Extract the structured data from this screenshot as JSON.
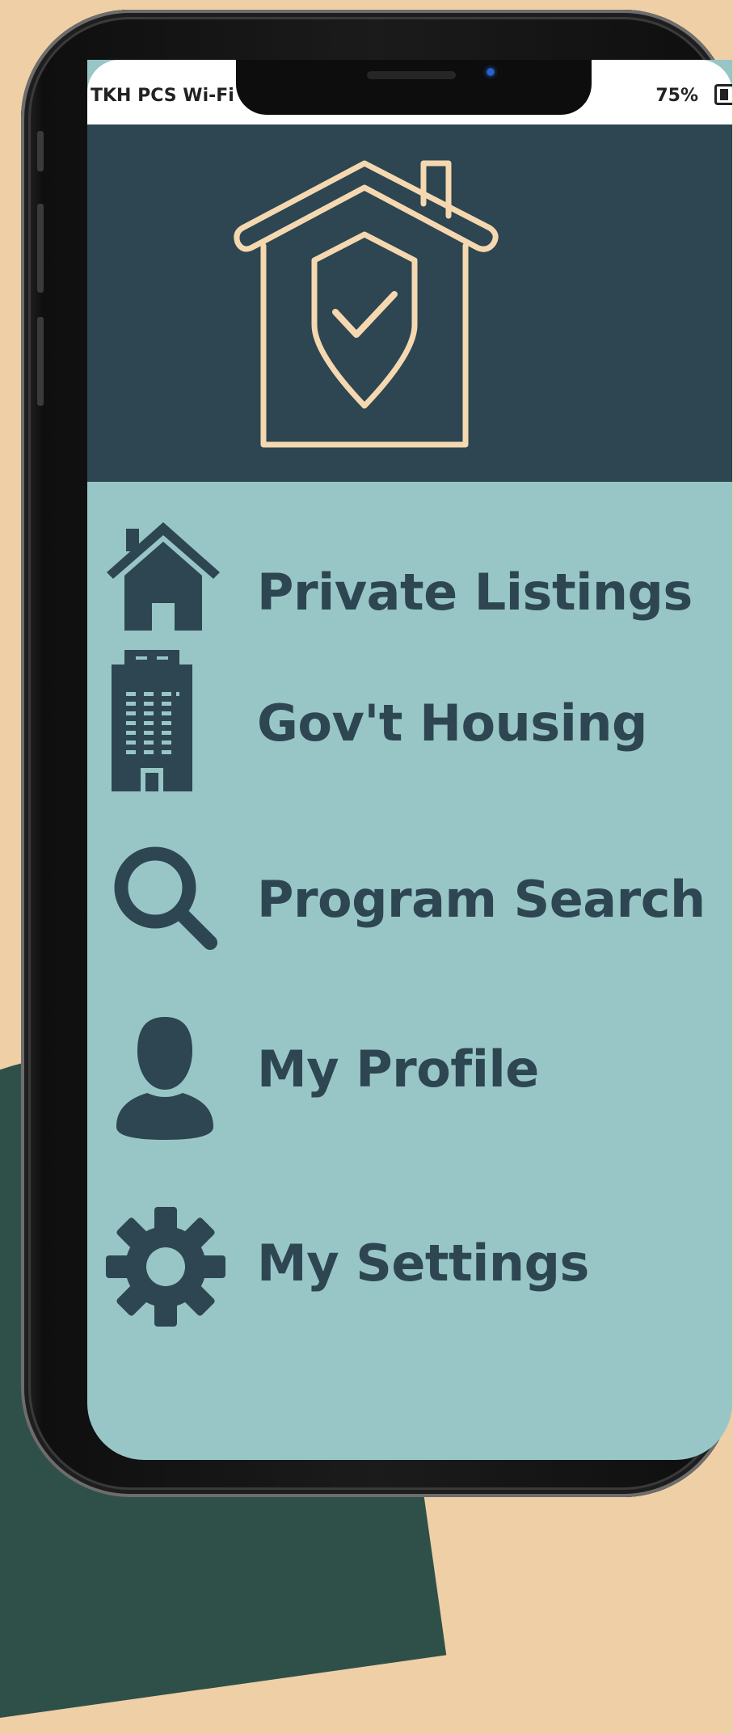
{
  "status_bar": {
    "carrier": "TKH PCS Wi-Fi",
    "battery_percent": "75%",
    "battery_icon": "battery-icon"
  },
  "hero": {
    "logo_icon": "house-shield-check-icon",
    "background_color": "#2D4651",
    "logo_color": "#F6D8B0"
  },
  "menu": {
    "items": [
      {
        "label": "Private Listings",
        "icon": "house-icon"
      },
      {
        "label": "Gov't Housing",
        "icon": "building-icon"
      },
      {
        "label": "Program Search",
        "icon": "search-icon"
      },
      {
        "label": "My Profile",
        "icon": "user-icon"
      },
      {
        "label": "My Settings",
        "icon": "gear-icon"
      }
    ],
    "background_color": "#98C6C6",
    "text_color": "#2D4651"
  }
}
